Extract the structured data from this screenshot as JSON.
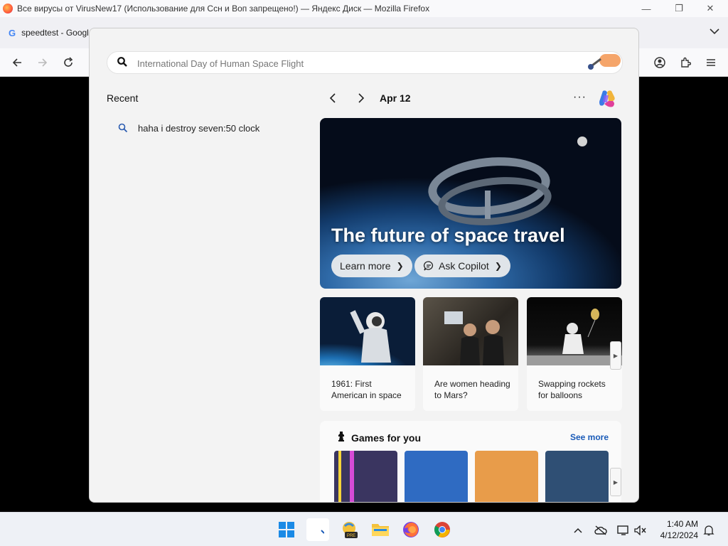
{
  "window": {
    "title": "Все вирусы от VirusNew17 (Использование для Ссн и Воп запрещено!) — Яндекс Диск — Mozilla Firefox",
    "tab_label": "speedtest - Googl"
  },
  "search": {
    "placeholder": "International Day of Human Space Flight",
    "value": ""
  },
  "recent": {
    "title": "Recent",
    "items": [
      {
        "label": "haha i destroy seven:50 clock"
      }
    ]
  },
  "highlights": {
    "date": "Apr 12",
    "more_label": "···",
    "hero": {
      "title": "The future of space travel",
      "learn_more": "Learn more",
      "ask_copilot": "Ask Copilot"
    },
    "cards": [
      {
        "caption": "1961: First American in space"
      },
      {
        "caption": "Are women heading to Mars?"
      },
      {
        "caption": "Swapping rockets for balloons"
      }
    ]
  },
  "games": {
    "title": "Games for you",
    "see_more": "See more",
    "tiles": [
      "#3a3560",
      "#2f6bc2",
      "#e89c4a",
      "#2f4f74"
    ]
  },
  "taskbar": {
    "time": "1:40 AM",
    "date": "4/12/2024",
    "pre_badge": "PRE"
  },
  "colors": {
    "accent_link": "#1a5bb8",
    "flyout_bg": "#f3f3f3"
  }
}
